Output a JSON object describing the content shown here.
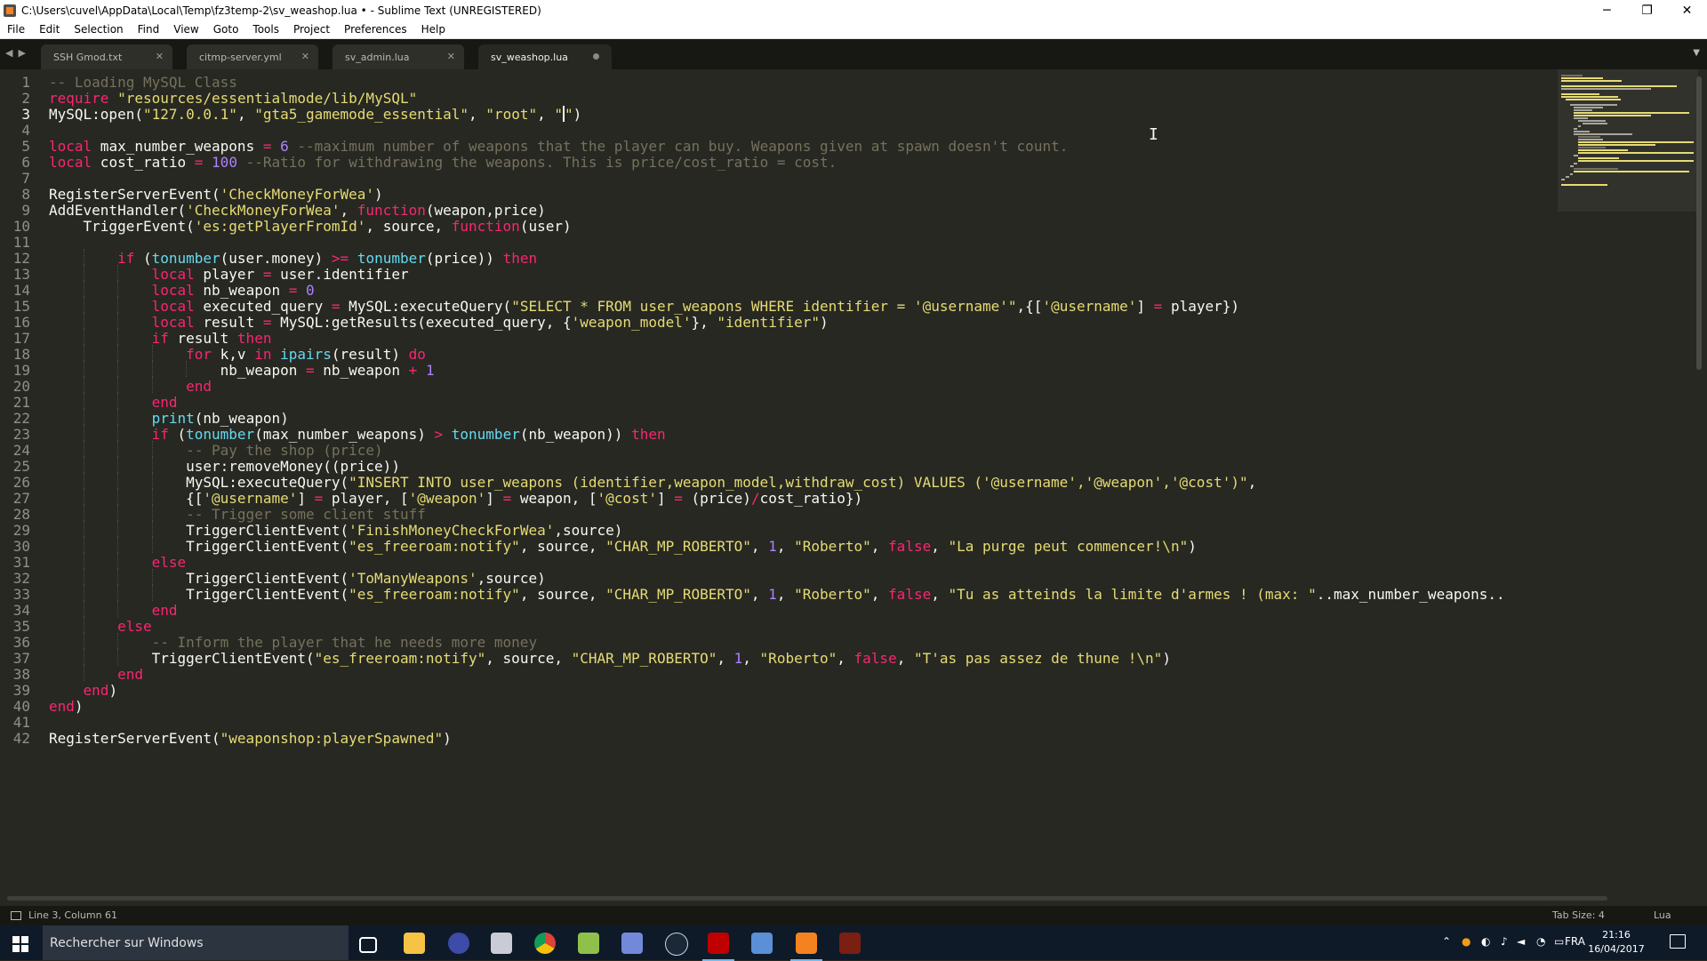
{
  "window": {
    "title": "C:\\Users\\cuvel\\AppData\\Local\\Temp\\fz3temp-2\\sv_weashop.lua • - Sublime Text (UNREGISTERED)",
    "controls": {
      "minimize": "─",
      "maximize": "❐",
      "close": "✕"
    }
  },
  "menu": [
    "File",
    "Edit",
    "Selection",
    "Find",
    "View",
    "Goto",
    "Tools",
    "Project",
    "Preferences",
    "Help"
  ],
  "tabs": [
    {
      "label": "SSH Gmod.txt",
      "active": false,
      "dirty": false
    },
    {
      "label": "citmp-server.yml",
      "active": false,
      "dirty": false
    },
    {
      "label": "sv_admin.lua",
      "active": false,
      "dirty": false
    },
    {
      "label": "sv_weashop.lua",
      "active": true,
      "dirty": true
    }
  ],
  "editor": {
    "current_line": 3,
    "lines": [
      "-- Loading MySQL Class",
      "require \"resources/essentialmode/lib/MySQL\"",
      "MySQL:open(\"127.0.0.1\", \"gta5_gamemode_essential\", \"root\", \"\")",
      "",
      "local max_number_weapons = 6 --maximum number of weapons that the player can buy. Weapons given at spawn doesn't count.",
      "local cost_ratio = 100 --Ratio for withdrawing the weapons. This is price/cost_ratio = cost.",
      "",
      "RegisterServerEvent('CheckMoneyForWea')",
      "AddEventHandler('CheckMoneyForWea', function(weapon,price)",
      "    TriggerEvent('es:getPlayerFromId', source, function(user)",
      "",
      "        if (tonumber(user.money) >= tonumber(price)) then",
      "            local player = user.identifier",
      "            local nb_weapon = 0",
      "            local executed_query = MySQL:executeQuery(\"SELECT * FROM user_weapons WHERE identifier = '@username'\",{['@username'] = player})",
      "            local result = MySQL:getResults(executed_query, {'weapon_model'}, \"identifier\")",
      "            if result then",
      "                for k,v in ipairs(result) do",
      "                    nb_weapon = nb_weapon + 1",
      "                end",
      "            end",
      "            print(nb_weapon)",
      "            if (tonumber(max_number_weapons) > tonumber(nb_weapon)) then",
      "                -- Pay the shop (price)",
      "                user:removeMoney((price))",
      "                MySQL:executeQuery(\"INSERT INTO user_weapons (identifier,weapon_model,withdraw_cost) VALUES ('@username','@weapon','@cost')\",",
      "                {['@username'] = player, ['@weapon'] = weapon, ['@cost'] = (price)/cost_ratio})",
      "                -- Trigger some client stuff",
      "                TriggerClientEvent('FinishMoneyCheckForWea',source)",
      "                TriggerClientEvent(\"es_freeroam:notify\", source, \"CHAR_MP_ROBERTO\", 1, \"Roberto\", false, \"La purge peut commencer!\\n\")",
      "            else",
      "                TriggerClientEvent('ToManyWeapons',source)",
      "                TriggerClientEvent(\"es_freeroam:notify\", source, \"CHAR_MP_ROBERTO\", 1, \"Roberto\", false, \"Tu as atteinds la limite d'armes ! (max: \"..max_number_weapons..",
      "            end",
      "        else",
      "            -- Inform the player that he needs more money",
      "            TriggerClientEvent(\"es_freeroam:notify\", source, \"CHAR_MP_ROBERTO\", 1, \"Roberto\", false, \"T'as pas assez de thune !\\n\")",
      "        end",
      "    end)",
      "end)",
      "",
      "RegisterServerEvent(\"weaponshop:playerSpawned\")"
    ]
  },
  "status": {
    "position": "Line 3, Column 61",
    "tab_size": "Tab Size: 4",
    "syntax": "Lua"
  },
  "taskbar": {
    "search_placeholder": "Rechercher sur Windows",
    "icons": [
      "task-view-icon",
      "file-explorer-icon",
      "media-player-icon",
      "mail-icon",
      "chrome-icon",
      "notepad-plus-icon",
      "discord-icon",
      "steam-icon",
      "filezilla-icon",
      "remote-desktop-icon",
      "sublime-text-icon",
      "brackets-icon"
    ],
    "language": "FRA",
    "time": "21:16",
    "date": "16/04/2017"
  },
  "colors": {
    "background": "#272822",
    "keyword": "#f92672",
    "string": "#e6db74",
    "comment": "#75715e",
    "number": "#ae81ff",
    "builtin": "#66d9ef"
  }
}
